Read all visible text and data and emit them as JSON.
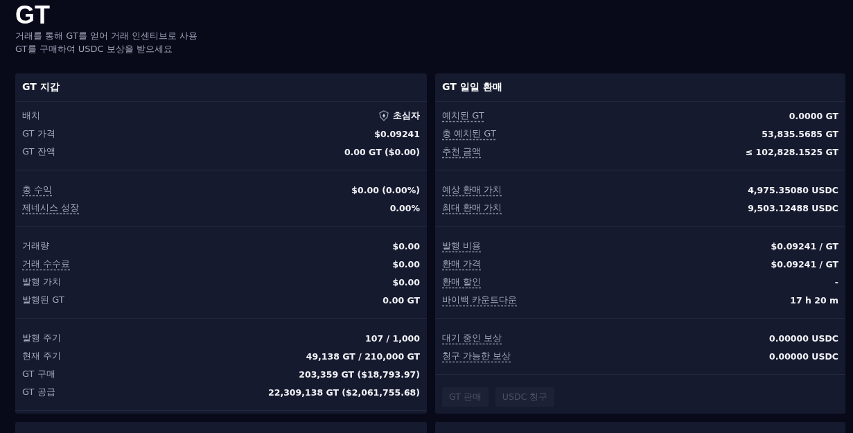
{
  "page": {
    "title": "GT",
    "subtitle_lines": [
      "거래를 통해 GT를 얻어 거래 인센티브로 사용",
      "GT를 구매하여 USDC 보상을 받으세요"
    ]
  },
  "panels": [
    {
      "title": "GT 지갑",
      "sections": [
        [
          {
            "kind": "badge",
            "label": "배치",
            "underlined": false,
            "value": "초심자"
          },
          {
            "kind": "plain",
            "label": "GT 가격",
            "underlined": false,
            "value": "$0.09241"
          },
          {
            "kind": "plain",
            "label": "GT 잔액",
            "underlined": false,
            "value": "0.00 GT ($0.00)"
          }
        ],
        [
          {
            "kind": "plain",
            "label": "총 수익",
            "underlined": true,
            "value": "$0.00 (0.00%)"
          },
          {
            "kind": "plain",
            "label": "제네시스 성장",
            "underlined": true,
            "value": "0.00%"
          }
        ],
        [
          {
            "kind": "plain",
            "label": "거래량",
            "underlined": false,
            "value": "$0.00"
          },
          {
            "kind": "plain",
            "label": "거래 수수료",
            "underlined": true,
            "value": "$0.00"
          },
          {
            "kind": "plain",
            "label": "발행 가치",
            "underlined": false,
            "value": "$0.00"
          },
          {
            "kind": "plain",
            "label": "발행된 GT",
            "underlined": false,
            "value": "0.00 GT"
          }
        ],
        [
          {
            "kind": "plain",
            "label": "발행 주기",
            "underlined": false,
            "value": "107 / 1,000"
          },
          {
            "kind": "plain",
            "label": "현재 주기",
            "underlined": false,
            "value": "49,138 GT / 210,000 GT"
          },
          {
            "kind": "plain",
            "label": "GT 구매",
            "underlined": false,
            "value": "203,359 GT ($18,793.97)"
          },
          {
            "kind": "plain",
            "label": "GT 공급",
            "underlined": false,
            "value": "22,309,138 GT ($2,061,755.68)"
          }
        ]
      ]
    },
    {
      "title": "GT 일일 환매",
      "sections": [
        [
          {
            "kind": "plain",
            "label": "예치된 GT",
            "underlined": true,
            "value": "0.0000 GT"
          },
          {
            "kind": "plain",
            "label": "총 예치된 GT",
            "underlined": true,
            "value": "53,835.5685 GT"
          },
          {
            "kind": "plain",
            "label": "추천 금액",
            "underlined": true,
            "value": "≤ 102,828.1525 GT"
          }
        ],
        [
          {
            "kind": "plain",
            "label": "예상 환매 가치",
            "underlined": true,
            "value": "4,975.35080 USDC"
          },
          {
            "kind": "plain",
            "label": "최대 환매 가치",
            "underlined": true,
            "value": "9,503.12488 USDC"
          }
        ],
        [
          {
            "kind": "plain",
            "label": "발행 비용",
            "underlined": true,
            "value": "$0.09241 / GT"
          },
          {
            "kind": "plain",
            "label": "환매 가격",
            "underlined": true,
            "value": "$0.09241 / GT"
          },
          {
            "kind": "plain",
            "label": "환매 할인",
            "underlined": true,
            "value": "-"
          },
          {
            "kind": "plain",
            "label": "바이백 카운트다운",
            "underlined": true,
            "value": "17 h 20 m"
          }
        ],
        [
          {
            "kind": "plain",
            "label": "대기 중인 보상",
            "underlined": true,
            "value": "0.00000 USDC"
          },
          {
            "kind": "plain",
            "label": "청구 가능한 보상",
            "underlined": true,
            "value": "0.00000 USDC"
          }
        ]
      ],
      "buttons": [
        {
          "label": "GT 판매",
          "disabled": true
        },
        {
          "label": "USDC 청구",
          "disabled": true
        }
      ]
    }
  ]
}
